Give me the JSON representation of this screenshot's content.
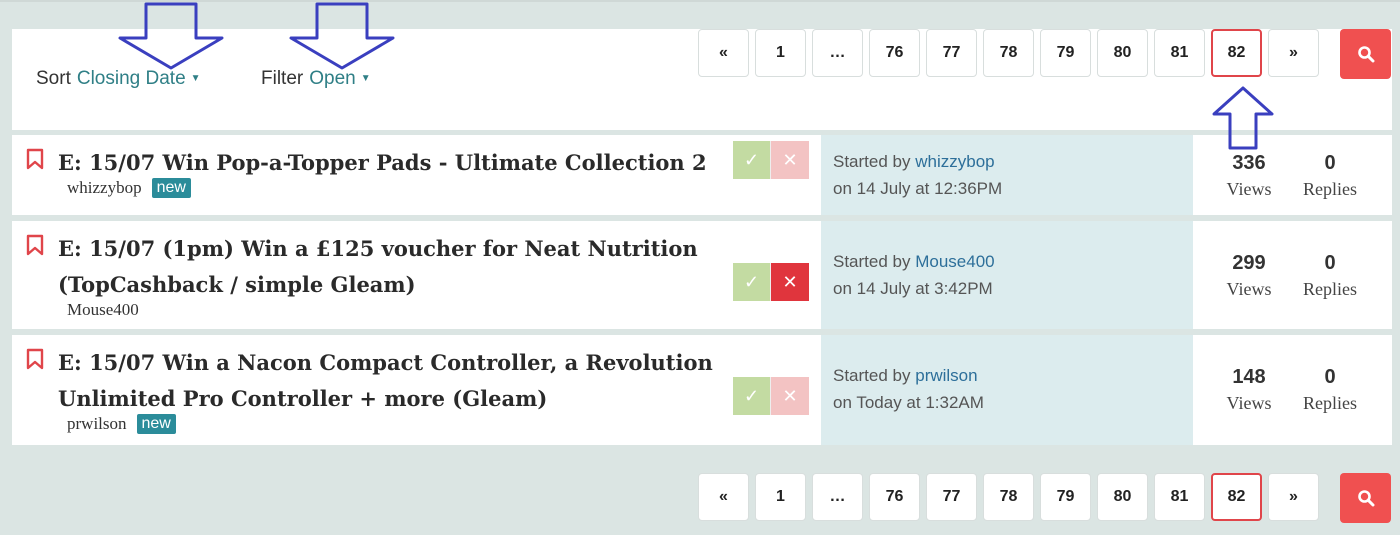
{
  "sort": {
    "label": "Sort",
    "value": "Closing Date"
  },
  "filter": {
    "label": "Filter",
    "value": "Open"
  },
  "pagination": {
    "prev": "«",
    "next": "»",
    "pages": [
      "1",
      "…",
      "76",
      "77",
      "78",
      "79",
      "80",
      "81",
      "82"
    ],
    "current": "82"
  },
  "topics": [
    {
      "title": "E: 15/07 Win Pop-a-Topper Pads - Ultimate Collection 2",
      "author": "whizzybop",
      "badge": "new",
      "vote": "none",
      "started_prefix": "Started by",
      "started_user": "whizzybop",
      "started_date": "on 14 July at 12:36PM",
      "views": "336",
      "views_label": "Views",
      "replies": "0",
      "replies_label": "Replies"
    },
    {
      "title": "E: 15/07 (1pm) Win a £125 voucher for Neat Nutrition (TopCashback / simple Gleam)",
      "author": "Mouse400",
      "badge": "",
      "vote": "down",
      "started_prefix": "Started by",
      "started_user": "Mouse400",
      "started_date": "on 14 July at 3:42PM",
      "views": "299",
      "views_label": "Views",
      "replies": "0",
      "replies_label": "Replies"
    },
    {
      "title": "E: 15/07 Win a Nacon Compact Controller, a Revolution Unlimited Pro Controller + more (Gleam)",
      "author": "prwilson",
      "badge": "new",
      "vote": "none",
      "started_prefix": "Started by",
      "started_user": "prwilson",
      "started_date": "on Today at 1:32AM",
      "views": "148",
      "views_label": "Views",
      "replies": "0",
      "replies_label": "Replies"
    }
  ],
  "colors": {
    "background": "#dbe5e3",
    "accent_teal": "#2f7f86",
    "search_red": "#f05050",
    "active_page_border": "#e0454a",
    "bookmark_red": "#e0454a",
    "annotation_arrow": "#3a3fbf"
  },
  "icons": {
    "bookmark": "bookmark-icon",
    "search": "search-icon",
    "vote_up": "check-icon",
    "vote_down": "x-icon"
  }
}
